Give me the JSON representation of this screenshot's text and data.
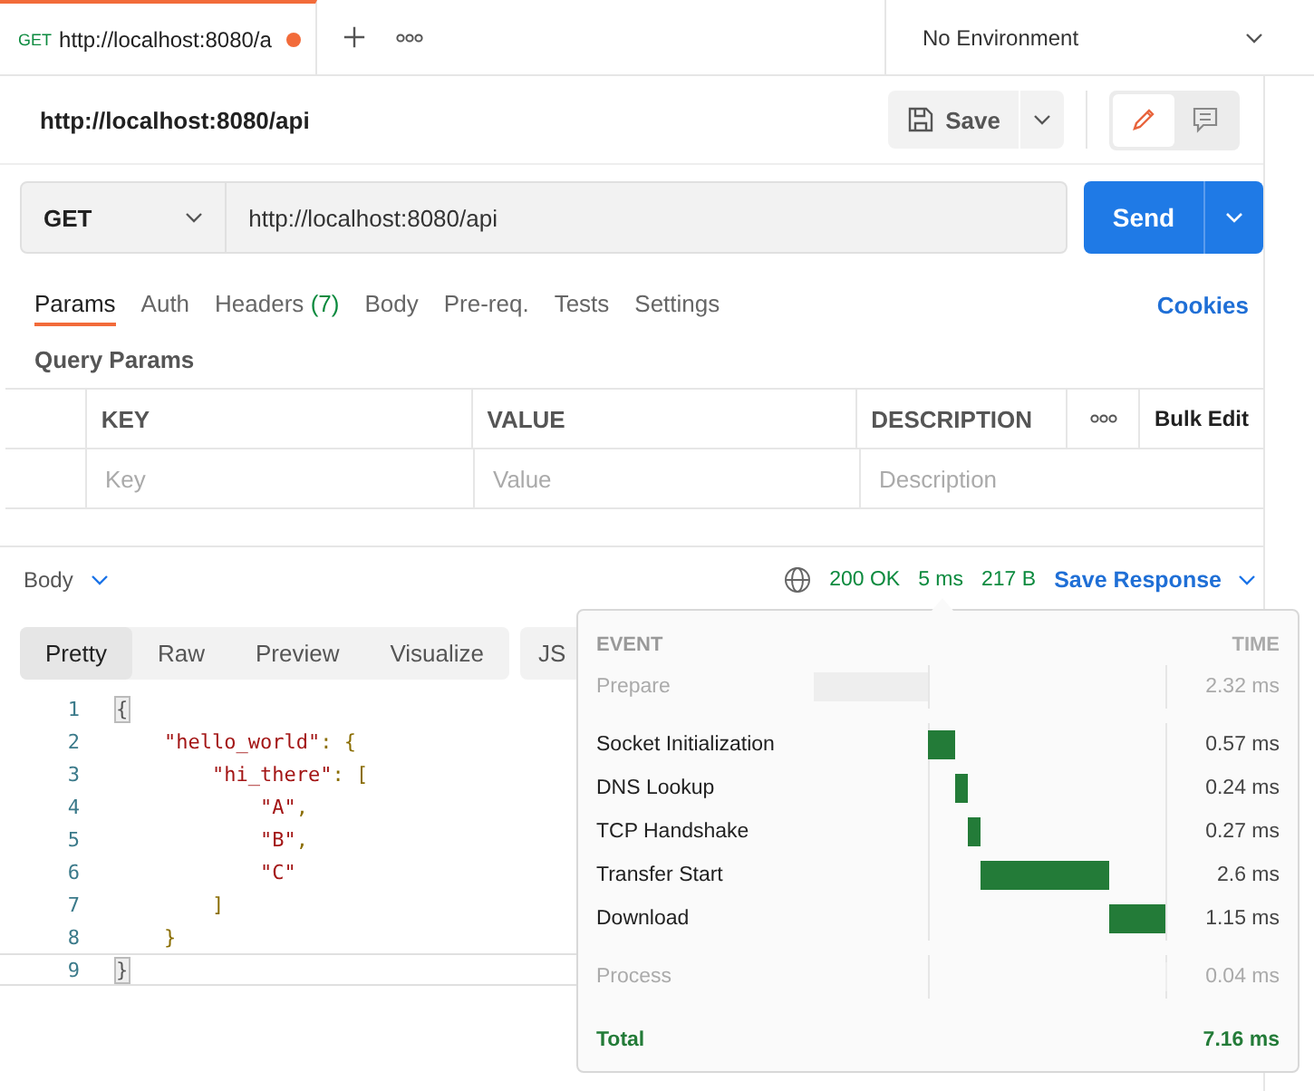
{
  "request_tab": {
    "method": "GET",
    "title": "http://localhost:8080/a",
    "unsaved": true
  },
  "environment": {
    "label": "No Environment"
  },
  "request_title": "http://localhost:8080/api",
  "save_button": {
    "label": "Save"
  },
  "mode_toggle": [
    {
      "kind": "edit",
      "selected": true
    },
    {
      "kind": "comment",
      "selected": false
    }
  ],
  "method": "GET",
  "url": "http://localhost:8080/api",
  "send_button": {
    "label": "Send"
  },
  "request_tabs": [
    {
      "label": "Params",
      "selected": true
    },
    {
      "label": "Auth",
      "selected": false
    },
    {
      "label": "Headers",
      "count": "(7)",
      "selected": false
    },
    {
      "label": "Body",
      "selected": false
    },
    {
      "label": "Pre-req.",
      "selected": false
    },
    {
      "label": "Tests",
      "selected": false
    },
    {
      "label": "Settings",
      "selected": false
    }
  ],
  "cookies_link": "Cookies",
  "query_params": {
    "title": "Query Params",
    "columns": [
      "KEY",
      "VALUE",
      "DESCRIPTION"
    ],
    "bulk_edit": "Bulk Edit",
    "placeholders": [
      "Key",
      "Value",
      "Description"
    ]
  },
  "response": {
    "section": "Body",
    "status": "200 OK",
    "time": "5 ms",
    "size": "217 B",
    "save_response": "Save Response"
  },
  "view_tabs": [
    {
      "label": "Pretty",
      "selected": true
    },
    {
      "label": "Raw",
      "selected": false
    },
    {
      "label": "Preview",
      "selected": false
    },
    {
      "label": "Visualize",
      "selected": false
    }
  ],
  "format_select": "JS",
  "code_lines": [
    {
      "number": "1",
      "tokens": [
        {
          "text": "{",
          "kind": "match"
        }
      ],
      "current": false
    },
    {
      "number": "2",
      "tokens": [
        {
          "text": "    \"hello_world\"",
          "kind": "key"
        },
        {
          "text": ": {",
          "kind": "punct"
        }
      ],
      "current": false
    },
    {
      "number": "3",
      "tokens": [
        {
          "text": "        \"hi_there\"",
          "kind": "key"
        },
        {
          "text": ": [",
          "kind": "punct"
        }
      ],
      "current": false
    },
    {
      "number": "4",
      "tokens": [
        {
          "text": "            \"A\"",
          "kind": "string"
        },
        {
          "text": ",",
          "kind": "punct"
        }
      ],
      "current": false
    },
    {
      "number": "5",
      "tokens": [
        {
          "text": "            \"B\"",
          "kind": "string"
        },
        {
          "text": ",",
          "kind": "punct"
        }
      ],
      "current": false
    },
    {
      "number": "6",
      "tokens": [
        {
          "text": "            \"C\"",
          "kind": "string"
        }
      ],
      "current": false
    },
    {
      "number": "7",
      "tokens": [
        {
          "text": "        ]",
          "kind": "punct"
        }
      ],
      "current": false
    },
    {
      "number": "8",
      "tokens": [
        {
          "text": "    }",
          "kind": "punct"
        }
      ],
      "current": false
    },
    {
      "number": "9",
      "tokens": [
        {
          "text": "}",
          "kind": "match"
        }
      ],
      "current": true
    }
  ],
  "timing": {
    "event_header": "EVENT",
    "time_header": "TIME",
    "events": [
      {
        "name": "Prepare",
        "time": "2.32 ms",
        "kind": "phase"
      },
      {
        "name": "Socket Initialization",
        "time": "0.57 ms",
        "kind": "event"
      },
      {
        "name": "DNS Lookup",
        "time": "0.24 ms",
        "kind": "event"
      },
      {
        "name": "TCP Handshake",
        "time": "0.27 ms",
        "kind": "event"
      },
      {
        "name": "Transfer Start",
        "time": "2.6 ms",
        "kind": "event"
      },
      {
        "name": "Download",
        "time": "1.15 ms",
        "kind": "event"
      },
      {
        "name": "Process",
        "time": "0.04 ms",
        "kind": "phase"
      }
    ],
    "total_label": "Total",
    "total_time": "7.16 ms"
  }
}
